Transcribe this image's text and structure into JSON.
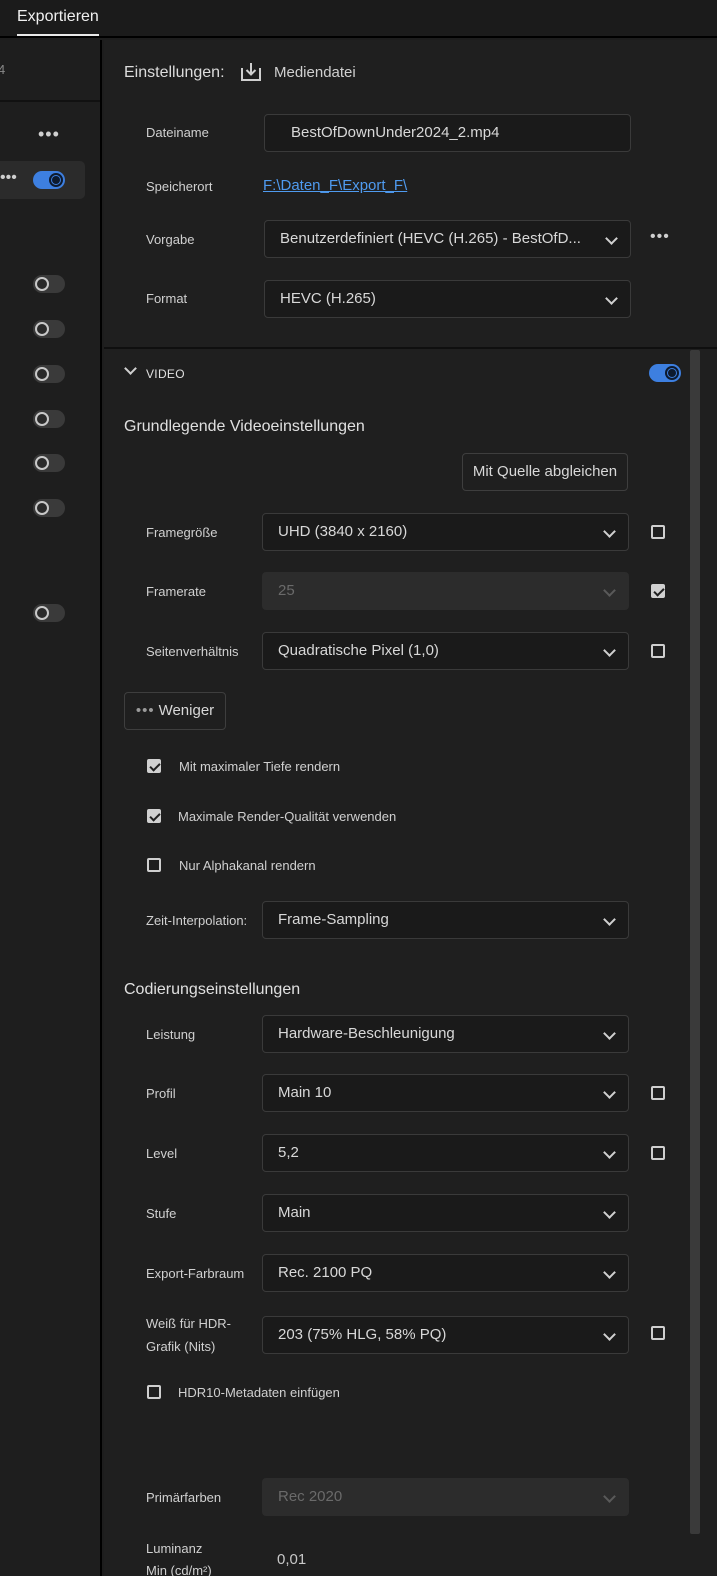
{
  "tabs": {
    "export_label": "Exportieren"
  },
  "left_panel": {
    "partial_number": "4"
  },
  "settings": {
    "header_label": "Einstellungen:",
    "media_label": "Mediendatei",
    "filename_label": "Dateiname",
    "filename_value": "BestOfDownUnder2024_2.mp4",
    "location_label": "Speicherort",
    "location_value": "F:\\Daten_F\\Export_F\\",
    "preset_label": "Vorgabe",
    "preset_value": "Benutzerdefiniert (HEVC (H.265) - BestOfD...",
    "format_label": "Format",
    "format_value": "HEVC (H.265)"
  },
  "video": {
    "section_label": "VIDEO",
    "basic_title": "Grundlegende Videoeinstellungen",
    "match_source_button": "Mit Quelle abgleichen",
    "frame_size_label": "Framegröße",
    "frame_size_value": "UHD (3840 x 2160)",
    "frame_rate_label": "Framerate",
    "frame_rate_value": "25",
    "aspect_label": "Seitenverhältnis",
    "aspect_value": "Quadratische Pixel (1,0)",
    "less_button": "Weniger",
    "max_depth_label": "Mit maximaler Tiefe rendern",
    "max_quality_label": "Maximale Render-Qualität verwenden",
    "alpha_only_label": "Nur Alphakanal rendern",
    "time_interp_label": "Zeit-Interpolation:",
    "time_interp_value": "Frame-Sampling"
  },
  "encoding": {
    "title": "Codierungseinstellungen",
    "performance_label": "Leistung",
    "performance_value": "Hardware-Beschleunigung",
    "profile_label": "Profil",
    "profile_value": "Main 10",
    "level_label": "Level",
    "level_value": "5,2",
    "tier_label": "Stufe",
    "tier_value": "Main",
    "colorspace_label": "Export-Farbraum",
    "colorspace_value": "Rec. 2100 PQ",
    "hdr_white_label_1": "Weiß für HDR-",
    "hdr_white_label_2": "Grafik (Nits)",
    "hdr_white_value": "203 (75% HLG, 58% PQ)",
    "hdr10_label": "HDR10-Metadaten einfügen",
    "primaries_label": "Primärfarben",
    "primaries_value": "Rec 2020",
    "luminance_label_1": "Luminanz",
    "luminance_label_2": "Min (cd/m²)",
    "luminance_value": "0,01"
  },
  "state": {
    "framerate_lock_checked": true,
    "max_depth_checked": true,
    "max_quality_checked": true,
    "alpha_only_checked": false,
    "hdr10_checked": false,
    "video_enabled": true
  }
}
